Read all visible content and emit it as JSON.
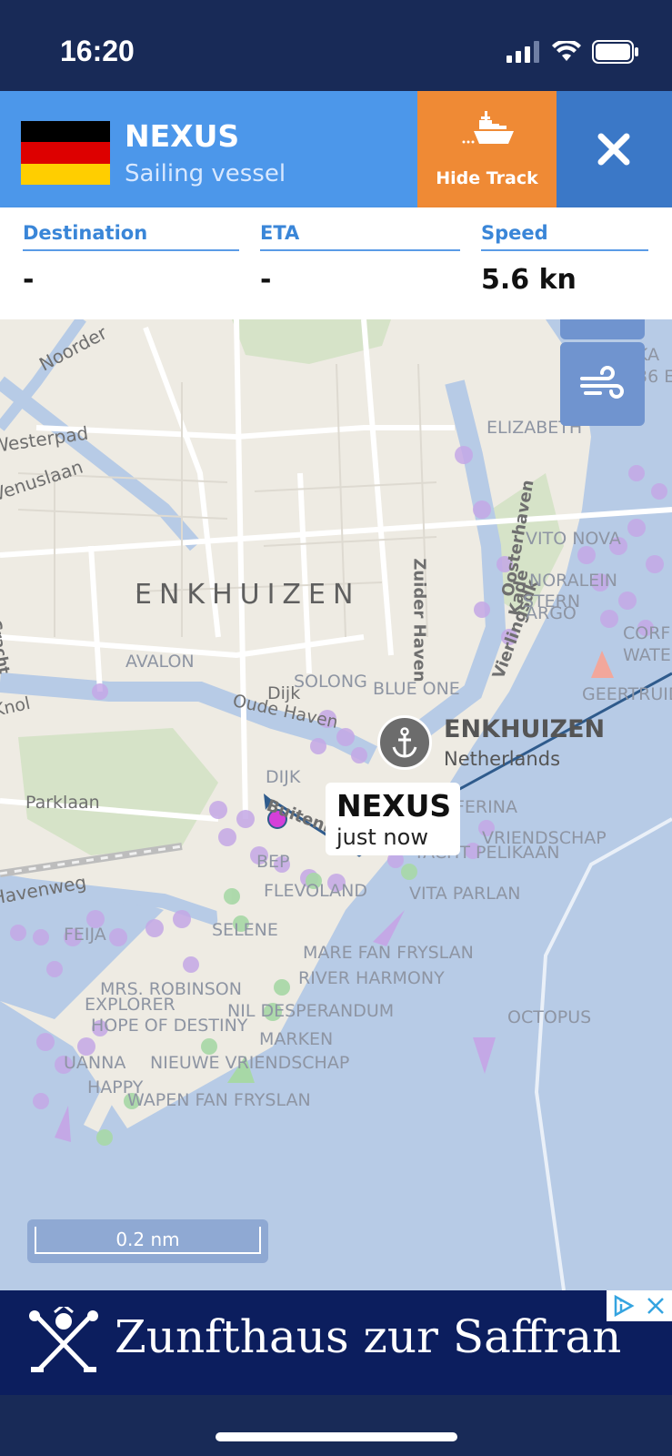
{
  "status_bar": {
    "time": "16:20"
  },
  "vessel": {
    "name": "NEXUS",
    "type": "Sailing vessel",
    "flag_colors": [
      "#000000",
      "#dd0000",
      "#ffce00"
    ]
  },
  "header_buttons": {
    "hide_track_label": "Hide Track",
    "close_icon": "close-icon"
  },
  "info": {
    "destination_label": "Destination",
    "destination_value": "-",
    "eta_label": "ETA",
    "eta_value": "-",
    "speed_label": "Speed",
    "speed_value": "5.6 kn"
  },
  "map": {
    "city_label": "ENKHUIZEN",
    "port": {
      "name": "ENKHUIZEN",
      "country": "Netherlands"
    },
    "callout": {
      "name": "NEXUS",
      "time": "just now"
    },
    "scale_label": "0.2 nm",
    "streets": [
      "Noorder",
      "Westerpad",
      "Venuslaan",
      "Zuider Haven",
      "Oosterhaven",
      "Oude Haven",
      "Dijk",
      "Parklaan",
      "Kade",
      "Knol",
      "Gracht",
      "Buitenhaven",
      "Vierlingsdk",
      "Havenweg"
    ],
    "ship_labels": [
      "ELIZABETH",
      "VITO NOVA",
      "NORALEIN",
      "STERN",
      "ARGO",
      "CORF",
      "WATE",
      "GEERTRUIDA",
      "AVALON",
      "SOLONG",
      "BLUE ONE",
      "FERINA",
      "DIJK",
      "VRIENDSCHAP",
      "YACHT PELIKAAN",
      "BEP",
      "VITA PARLAN",
      "FLEVOLAND",
      "SELENE",
      "MARE FAN FRYSLAN",
      "RIVER HARMONY",
      "MRS. ROBINSON",
      "EXPLORER",
      "NIL DESPERANDUM",
      "OCTOPUS",
      "MARKEN",
      "HOPE OF DESTINY",
      "UANNA",
      "NIEUWE VRIENDSCHAP",
      "HAPPY",
      "WAPEN FAN FRYSLAN",
      "KA",
      "36 E",
      "FEIJA"
    ],
    "colors": {
      "water": "#b7cbe6",
      "land": "#eeebe3",
      "track": "#2f5b8c",
      "vessel_dot": "#d43fd9",
      "ship_purple": "#c4a8e6"
    }
  },
  "ad": {
    "title": "Zunfthaus zur Saffran",
    "adchoice_icon": "adchoices-icon"
  }
}
